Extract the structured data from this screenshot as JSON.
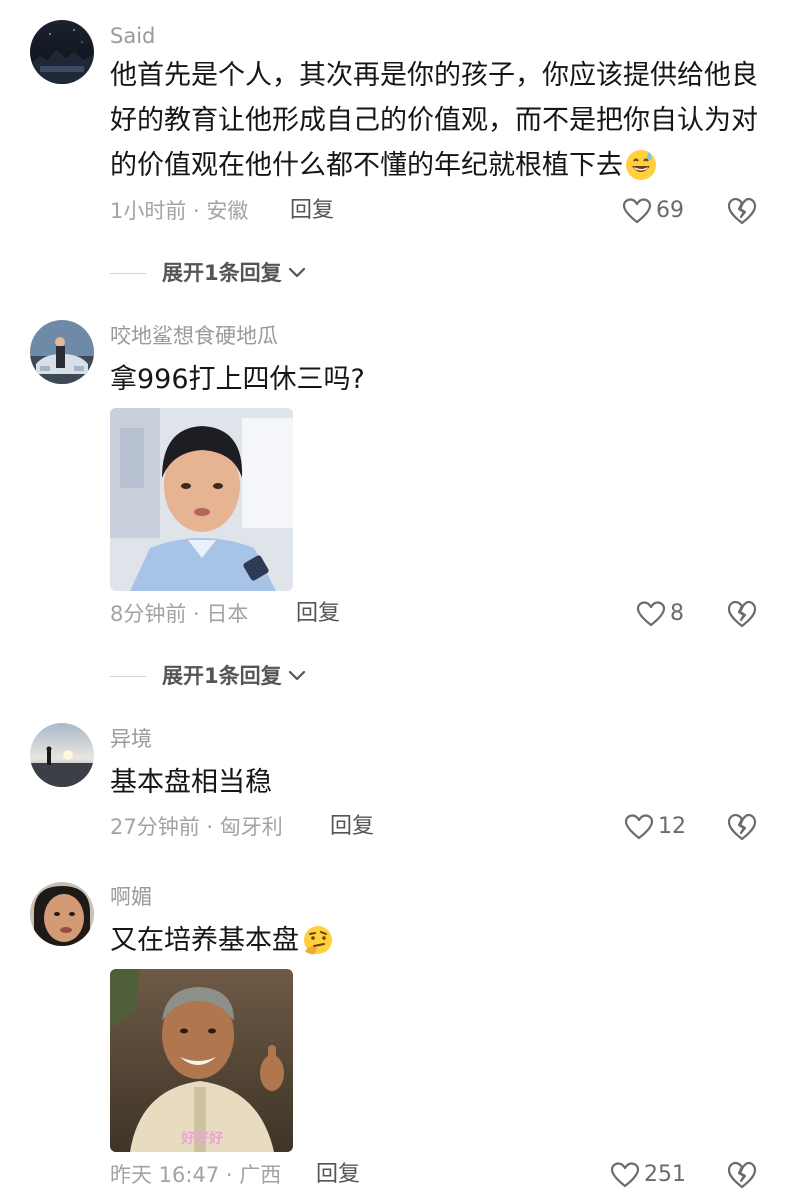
{
  "comments": [
    {
      "username": "Said",
      "text": "他首先是个人，其次再是你的孩子，你应该提供给他良好的教育让他形成自己的价值观，而不是把你自认为对的价值观在他什么都不懂的年纪就根植下去",
      "meta": "1小时前 · 安徽",
      "reply_label": "回复",
      "likes": "69",
      "expand_label": "展开1条回复",
      "emoji": "sweat-smile-emoji"
    },
    {
      "username": "咬地鲨想食硬地瓜",
      "text": "拿996打上四休三吗?",
      "meta": "8分钟前 · 日本",
      "reply_label": "回复",
      "likes": "8",
      "expand_label": "展开1条回复"
    },
    {
      "username": "异境",
      "text": "基本盘相当稳",
      "meta": "27分钟前 · 匈牙利",
      "reply_label": "回复",
      "likes": "12"
    },
    {
      "username": "啊媚",
      "text": "又在培养基本盘",
      "meta": "昨天 16:47 · 广西",
      "reply_label": "回复",
      "likes": "251",
      "emoji": "thinking-face-emoji",
      "sticker_text": "好好好"
    }
  ],
  "icons": {
    "like": "heart-outline-icon",
    "dislike": "broken-heart-icon",
    "expand": "chevron-down-icon"
  },
  "colors": {
    "username": "#9a9a9a",
    "meta": "#a3a3a3",
    "text": "#161616"
  }
}
